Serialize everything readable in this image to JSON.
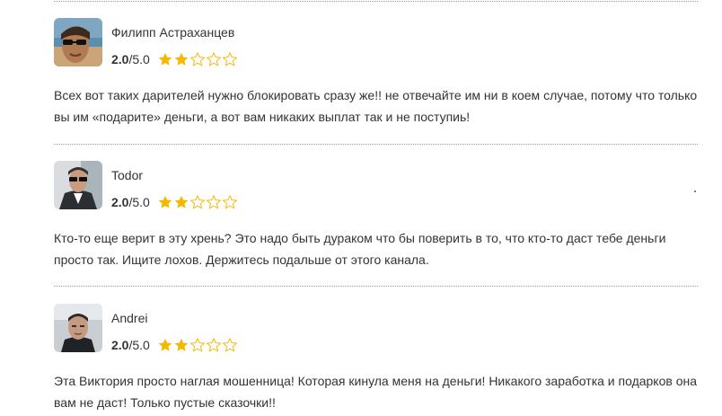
{
  "reviews": [
    {
      "author": "Филипп Астраханцев",
      "score": "2.0",
      "max": "/5.0",
      "stars_filled": 2,
      "stars_total": 5,
      "text": "Всех вот таких дарителей нужно блокировать сразу же!! не отвечайте им ни в коем случае, потому что только вы им «подарите» деньги, а вот вам никаких выплат так и не поступиь!"
    },
    {
      "author": "Todor",
      "score": "2.0",
      "max": "/5.0",
      "stars_filled": 2,
      "stars_total": 5,
      "text": "Кто-то еще верит в эту хрень? Это надо быть дураком что бы поверить в то, что кто-то даст тебе деньги просто так. Ищите лохов. Держитесь подальше от этого канала."
    },
    {
      "author": "Andrei",
      "score": "2.0",
      "max": "/5.0",
      "stars_filled": 2,
      "stars_total": 5,
      "text": "Эта Виктория просто наглая мошенница! Которая кинула меня на деньги! Никакого заработка и подарков она вам не даст! Только пустые сказочки!!"
    }
  ],
  "colors": {
    "star_filled": "#f5b800",
    "star_empty_stroke": "#f5b800",
    "divider": "#9a9a9a",
    "text": "#333333"
  },
  "icons": [
    "star-filled-icon",
    "star-empty-icon"
  ]
}
